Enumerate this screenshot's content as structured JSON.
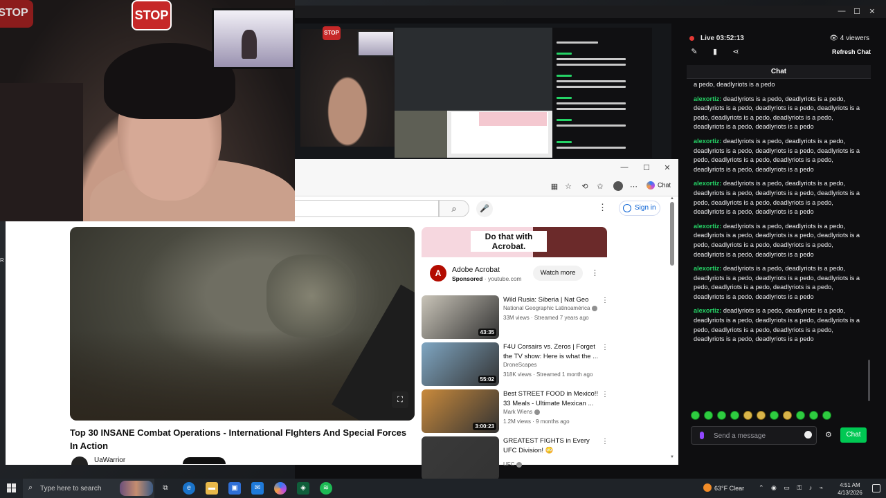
{
  "webcam": {
    "stop_sign": "STOP",
    "stop_sign_left": "STOP"
  },
  "stream_app": {
    "live_label": "Live",
    "live_time": "03:52:13",
    "viewers": "4 viewers",
    "refresh_chat": "Refresh Chat",
    "chat_title": "Chat",
    "send_placeholder": "Send a message",
    "chat_button": "Chat",
    "tool_icons": [
      "pencil-icon",
      "clip-icon",
      "share-icon"
    ],
    "messages": [
      {
        "user": "",
        "text": "a pedo, deadlyriots is a pedo"
      },
      {
        "user": "alexortiz:",
        "text": " deadlyriots is a pedo, deadlyriots is a pedo, deadlyriots is a pedo, deadlyriots is a pedo, deadlyriots is a pedo, deadlyriots is a pedo, deadlyriots is a pedo, deadlyriots is a pedo, deadlyriots is a pedo"
      },
      {
        "user": "alexortiz:",
        "text": " deadlyriots is a pedo, deadlyriots is a pedo, deadlyriots is a pedo, deadlyriots is a pedo, deadlyriots is a pedo, deadlyriots is a pedo, deadlyriots is a pedo, deadlyriots is a pedo, deadlyriots is a pedo"
      },
      {
        "user": "alexortiz:",
        "text": " deadlyriots is a pedo, deadlyriots is a pedo, deadlyriots is a pedo, deadlyriots is a pedo, deadlyriots is a pedo, deadlyriots is a pedo, deadlyriots is a pedo, deadlyriots is a pedo, deadlyriots is a pedo"
      },
      {
        "user": "alexortiz:",
        "text": " deadlyriots is a pedo, deadlyriots is a pedo, deadlyriots is a pedo, deadlyriots is a pedo, deadlyriots is a pedo, deadlyriots is a pedo, deadlyriots is a pedo, deadlyriots is a pedo, deadlyriots is a pedo"
      },
      {
        "user": "alexortiz:",
        "text": " deadlyriots is a pedo, deadlyriots is a pedo, deadlyriots is a pedo, deadlyriots is a pedo, deadlyriots is a pedo, deadlyriots is a pedo, deadlyriots is a pedo, deadlyriots is a pedo, deadlyriots is a pedo"
      },
      {
        "user": "alexortiz:",
        "text": " deadlyriots is a pedo, deadlyriots is a pedo, deadlyriots is a pedo, deadlyriots is a pedo, deadlyriots is a pedo, deadlyriots is a pedo, deadlyriots is a pedo, deadlyriots is a pedo, deadlyriots is a pedo"
      }
    ],
    "accent_color": "#25d366",
    "chat_button_color": "#00c853",
    "live_dot_color": "#e53935"
  },
  "browser": {
    "copilot_label": "Chat",
    "signin_label": "Sign in",
    "search_icon": "search-icon",
    "voice_icon": "mic-icon"
  },
  "video": {
    "title": "Top 30 INSANE Combat Operations - International FIghters And Special Forces In Action",
    "channel": "UaWarrior"
  },
  "ad": {
    "headline": "Do that with Acrobat.",
    "name": "Adobe Acrobat",
    "sponsored": "Sponsored",
    "domain": "youtube.com",
    "cta": "Watch more"
  },
  "recommendations": [
    {
      "title": "Wild Rusia: Siberia | Nat Geo",
      "channel": "National Geographic Latinoamérica",
      "meta": "33M views · Streamed 7 years ago",
      "duration": "43:35",
      "thumb_color": "#c9c4b8",
      "verified": true
    },
    {
      "title": "F4U Corsairs vs. Zeros | Forget the TV show: Here is what the ...",
      "channel": "DroneScapes",
      "meta": "318K views · Streamed 1 month ago",
      "duration": "55:02",
      "thumb_color": "#7fa6c2",
      "verified": false
    },
    {
      "title": "Best STREET FOOD in Mexico!! 33 Meals - Ultimate Mexican ...",
      "channel": "Mark Wiens",
      "meta": "1.2M views · 9 months ago",
      "duration": "3:00:23",
      "thumb_color": "#c98a3c",
      "verified": true
    },
    {
      "title": "GREATEST FIGHTS in Every UFC Division! 😳",
      "channel": "UFC",
      "meta": "",
      "duration": "",
      "thumb_color": "#3a3a3a",
      "verified": true
    }
  ],
  "taskbar": {
    "search_placeholder": "Type here to search",
    "weather": "63°F  Clear",
    "time": "4:51 AM",
    "date": "4/13/2026",
    "apps": [
      "task-view-icon",
      "edge-icon",
      "file-explorer-icon",
      "store-icon",
      "mail-icon",
      "copilot-icon",
      "app-icon",
      "spotify-icon"
    ]
  }
}
